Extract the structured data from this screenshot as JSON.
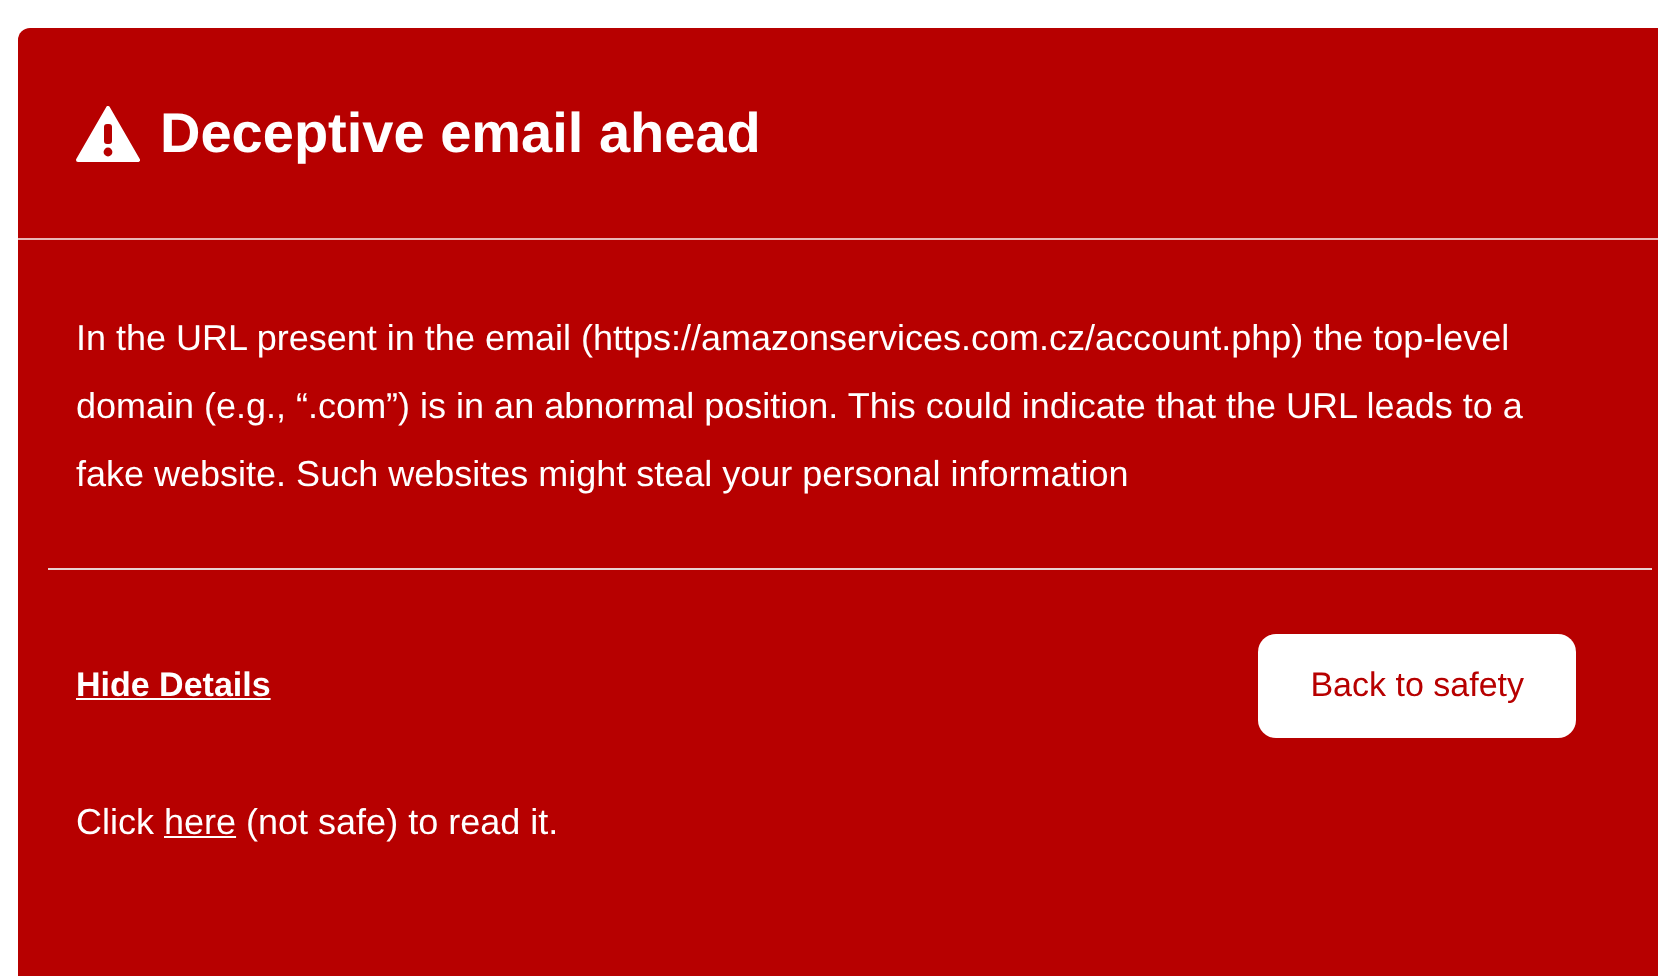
{
  "title": "Deceptive email ahead",
  "message": "In the URL present in the email (https://amazonservices.com.cz/account.php) the top-level domain (e.g., “.com”) is in an abnormal position. This could indicate that the URL leads to a fake website. Such websites might steal your personal information",
  "hide_details_link": "Hide Details",
  "back_button": "Back to safety",
  "footer": {
    "prefix": "Click ",
    "link": "here",
    "suffix": " (not safe) to read it."
  }
}
